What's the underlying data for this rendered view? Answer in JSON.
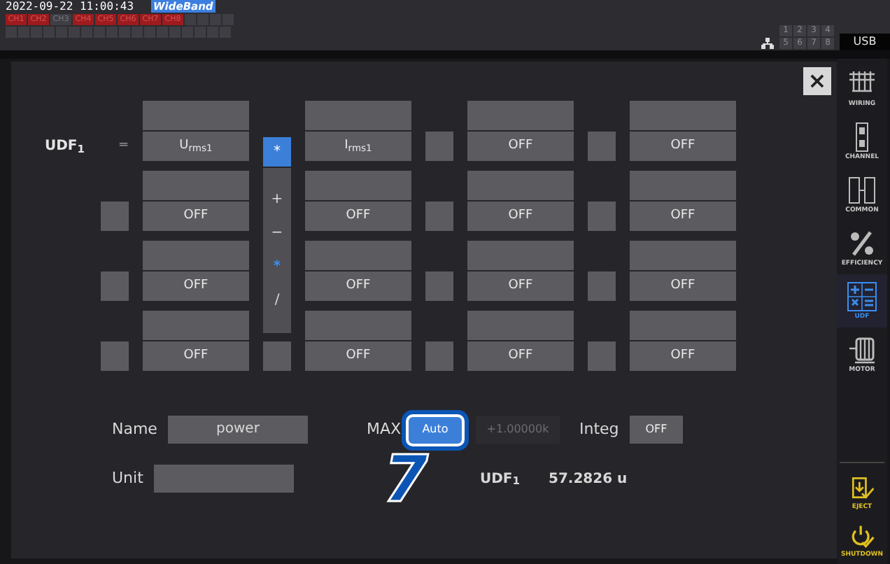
{
  "status_bar": {
    "datetime": "2022-09-22 11:00:43",
    "mode": "WideBand",
    "channels": [
      {
        "label": "CH1",
        "active": true
      },
      {
        "label": "CH2",
        "active": true
      },
      {
        "label": "CH3",
        "active": false
      },
      {
        "label": "CH4",
        "active": true
      },
      {
        "label": "CH5",
        "active": true
      },
      {
        "label": "CH6",
        "active": true
      },
      {
        "label": "CH7",
        "active": true
      },
      {
        "label": "CH8",
        "active": true
      }
    ],
    "ports": [
      "1",
      "2",
      "3",
      "4",
      "5",
      "6",
      "7",
      "8"
    ],
    "storage": "USB"
  },
  "dialog": {
    "close": "×",
    "target": "UDF$_{1}$",
    "rows": [
      {
        "lead": "=",
        "terms": [
          {
            "operand": "U$_{rms1}$"
          },
          {
            "op": "*",
            "op_selected": true,
            "operand": "I$_{rms1}$"
          },
          {
            "op_selected": false,
            "operand": "OFF"
          },
          {
            "op_selected": false,
            "operand": "OFF"
          }
        ]
      },
      {
        "terms": [
          {
            "operand": "OFF"
          },
          {
            "operand": "OFF"
          },
          {
            "op_selected": false,
            "operand": "OFF"
          },
          {
            "op_selected": false,
            "operand": "OFF"
          }
        ]
      },
      {
        "terms": [
          {
            "operand": "OFF"
          },
          {
            "operand": "OFF"
          },
          {
            "op_selected": false,
            "operand": "OFF"
          },
          {
            "op_selected": false,
            "operand": "OFF"
          }
        ]
      },
      {
        "terms": [
          {
            "operand": "OFF"
          },
          {
            "op_selected": false,
            "operand": "OFF"
          },
          {
            "op_selected": false,
            "operand": "OFF"
          },
          {
            "op_selected": false,
            "operand": "OFF"
          }
        ]
      }
    ],
    "operator_menu": [
      {
        "label": "+",
        "selected": false
      },
      {
        "label": "−",
        "selected": false
      },
      {
        "label": "*",
        "selected": true
      },
      {
        "label": "/",
        "selected": false
      }
    ],
    "name_label": "Name",
    "name_value": "power",
    "max_label": "MAX",
    "max_mode": {
      "label": "Auto",
      "selected": true
    },
    "max_value": {
      "text": "+1.00000k",
      "disabled": true
    },
    "integ_label": "Integ",
    "integ_value": "OFF",
    "unit_label": "Unit",
    "result_label": "UDF$_{1}$",
    "result_value": "57.2826 u"
  },
  "callout": "7",
  "sidebar": {
    "items": [
      {
        "label": "WIRING",
        "selected": false
      },
      {
        "label": "CHANNEL",
        "selected": false
      },
      {
        "label": "COMMON",
        "selected": false
      },
      {
        "label": "EFFICIENCY",
        "selected": false
      },
      {
        "label": "UDF",
        "selected": true
      },
      {
        "label": "MOTOR",
        "selected": false
      }
    ],
    "actions": [
      {
        "label": "EJECT"
      },
      {
        "label": "SHUTDOWN"
      }
    ]
  }
}
